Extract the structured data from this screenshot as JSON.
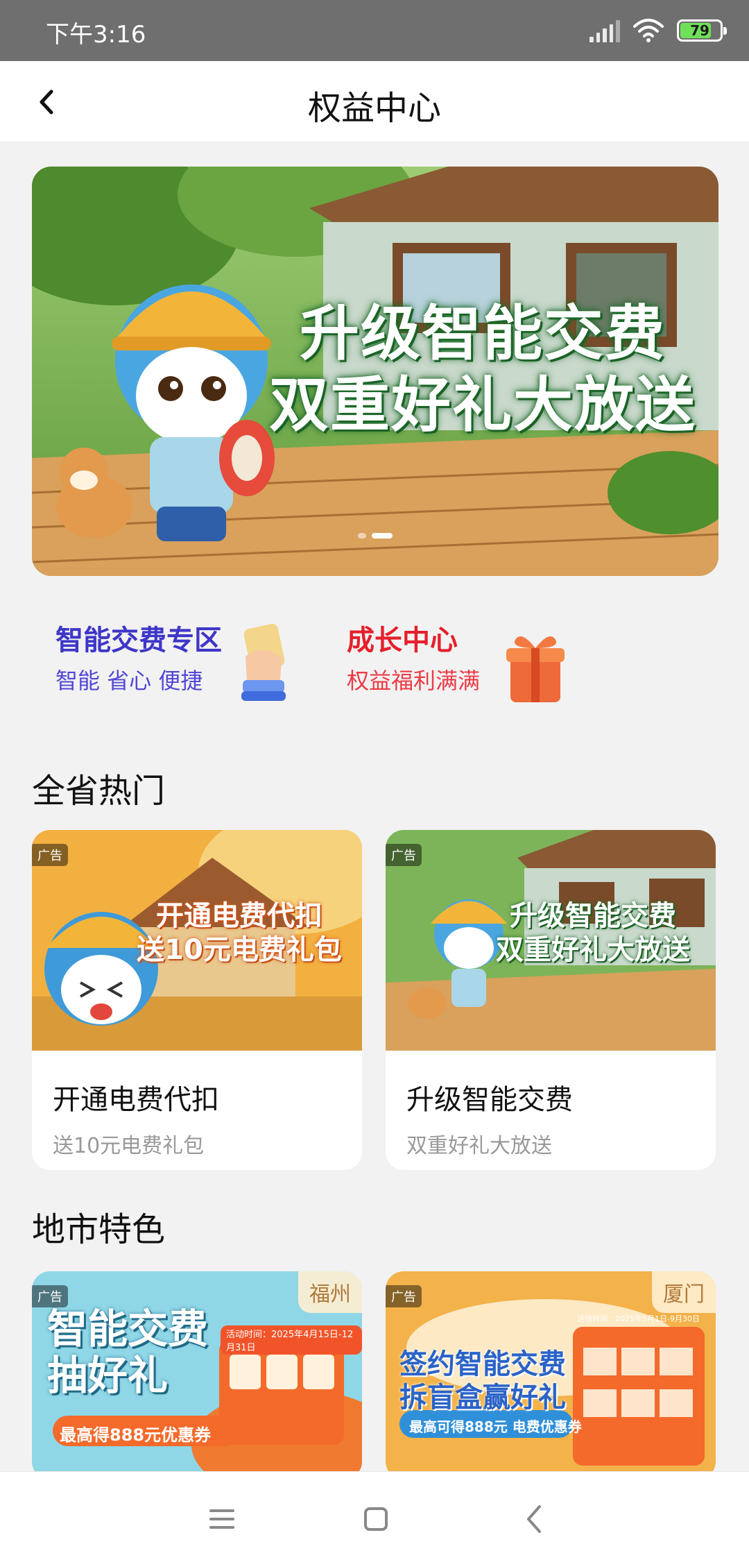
{
  "status_bar": {
    "time": "下午3:16",
    "battery": "79",
    "icons": [
      "signal-icon",
      "wifi-icon",
      "battery-icon"
    ]
  },
  "nav": {
    "title": "权益中心",
    "back_icon": "chevron-left-icon"
  },
  "banner": {
    "line1": "升级智能交费",
    "line2": "双重好礼大放送",
    "dots": 2,
    "active_dot": 1
  },
  "quick_entries": [
    {
      "title": "智能交费专区",
      "subtitle": "智能 省心 便捷",
      "icon": "hand-card-icon",
      "color": "#3e36c8"
    },
    {
      "title": "成长中心",
      "subtitle": "权益福利满满",
      "icon": "gift-box-icon",
      "color": "#e5202c"
    }
  ],
  "sections": {
    "hot": {
      "title": "全省热门",
      "cards": [
        {
          "ad": "广告",
          "overlay1": "开通电费代扣",
          "overlay2": "送10元电费礼包",
          "name": "开通电费代扣",
          "sub": "送10元电费礼包"
        },
        {
          "ad": "广告",
          "overlay1": "升级智能交费",
          "overlay2": "双重好礼大放送",
          "name": "升级智能交费",
          "sub": "双重好礼大放送"
        }
      ]
    },
    "local": {
      "title": "地市特色",
      "cards": [
        {
          "ad": "广告",
          "city": "福州",
          "overlay1": "智能交费",
          "overlay2": "抽好礼",
          "note": "最高得888元优惠券",
          "period": "活动时间：2025年4月15日-12月31日"
        },
        {
          "ad": "广告",
          "city": "厦门",
          "overlay1": "签约智能交费",
          "overlay2": "拆盲盒赢好礼",
          "note": "最高可得888元 电费优惠券",
          "period": "活动时间：2025年5月1日-9月30日"
        }
      ]
    }
  },
  "system_nav": {
    "icons": [
      "menu-icon",
      "home-square-icon",
      "back-triangle-icon"
    ]
  },
  "colors": {
    "status_bar": "#6f6f6f",
    "background": "#f2f2f2",
    "green_text_shadow": "#1d6b2a"
  }
}
